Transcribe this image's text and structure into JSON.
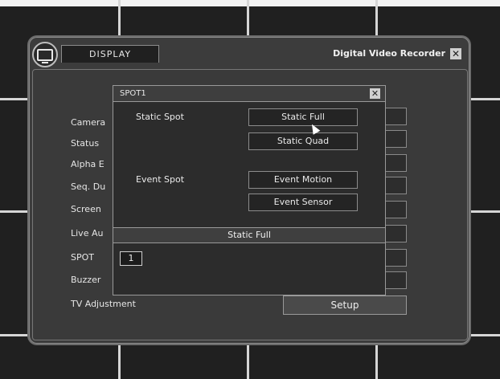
{
  "window": {
    "tab_label": "DISPLAY",
    "title": "Digital Video Recorder",
    "close_icon": "close-icon"
  },
  "settings": {
    "items": [
      {
        "label": "Camera"
      },
      {
        "label": "Status"
      },
      {
        "label": "Alpha E"
      },
      {
        "label": "Seq. Du"
      },
      {
        "label": "Screen"
      },
      {
        "label": "Live Au"
      },
      {
        "label": "SPOT"
      },
      {
        "label": "Buzzer"
      },
      {
        "label": "TV Adjustment"
      }
    ],
    "setup_label": "Setup"
  },
  "popup": {
    "title": "SPOT1",
    "static_spot_label": "Static Spot",
    "event_spot_label": "Event Spot",
    "options": {
      "static_full": "Static Full",
      "static_quad": "Static Quad",
      "event_motion": "Event Motion",
      "event_sensor": "Event Sensor"
    },
    "current_selection": "Static Full",
    "spot_number": "1"
  }
}
